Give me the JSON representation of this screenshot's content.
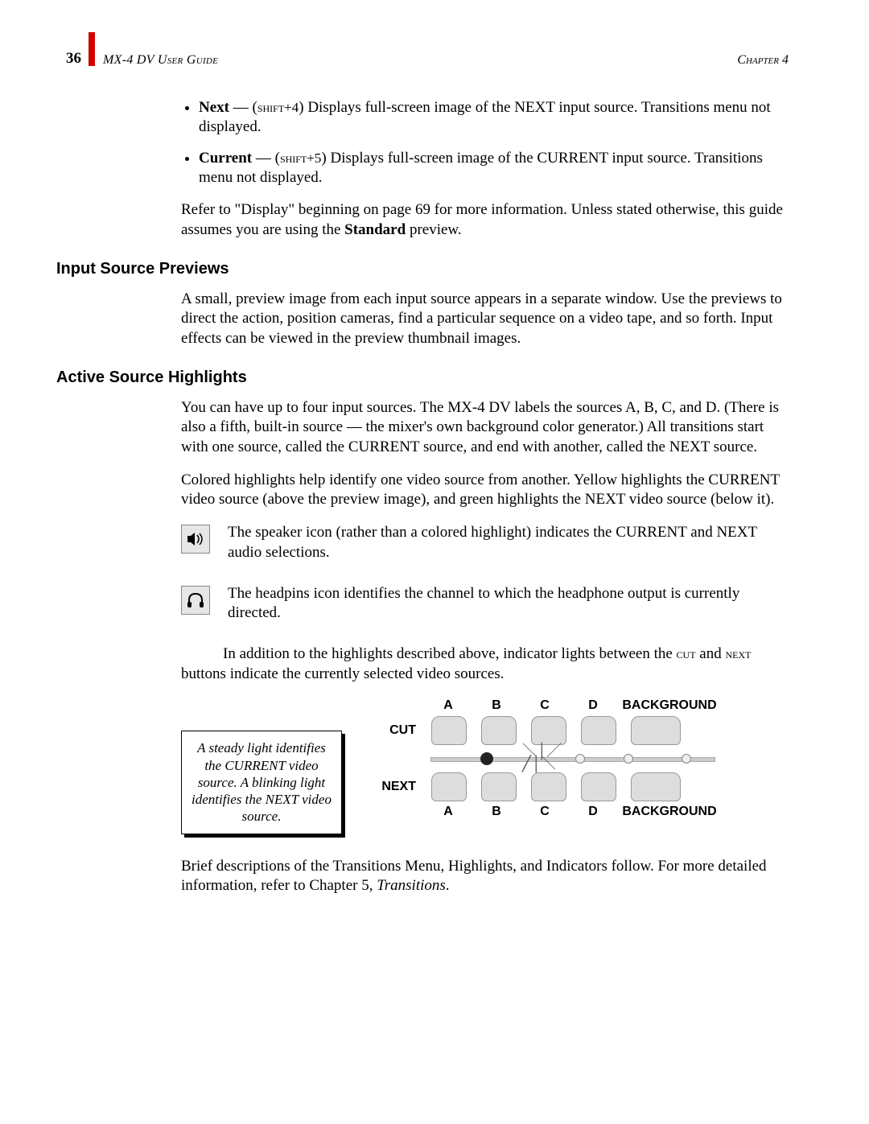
{
  "header": {
    "page_number": "36",
    "guide": "MX-4 DV User Guide",
    "chapter": "Chapter 4"
  },
  "bullets": {
    "next": {
      "label": "Next",
      "shortcut": "shift+4",
      "desc": ") Displays full-screen image of the NEXT input source. Transitions menu not displayed."
    },
    "current": {
      "label": "Current",
      "shortcut": "shift+5",
      "desc": ") Displays full-screen image of the CURRENT input source. Transitions menu not displayed."
    }
  },
  "refer_para_a": "Refer to \"Display\" beginning on page 69 for more information. Unless stated otherwise, this guide assumes you are using the ",
  "refer_bold": "Standard",
  "refer_para_b": " preview.",
  "sections": {
    "input_previews": {
      "heading": "Input Source Previews",
      "para": "A small, preview image from each input source appears in a separate window. Use the previews to direct the action, position cameras, find a particular sequence on a video tape, and so forth. Input effects can be viewed in the preview thumbnail images."
    },
    "active_highlights": {
      "heading": "Active Source Highlights",
      "para1": "You can have up to four input sources. The MX-4 DV labels the sources A, B, C, and D. (There is also a fifth, built-in source — the mixer's own background color generator.) All transitions start with one source, called the CURRENT source, and end with another, called the NEXT source.",
      "para2": "Colored highlights help identify one video source from another. Yellow highlights the CURRENT video source (above the preview image), and green highlights the NEXT video source (below it).",
      "speaker": "The speaker icon (rather than a colored highlight) indicates the CURRENT and NEXT audio selections.",
      "headphones": "The headpins icon identifies the channel to which the headphone output is currently directed.",
      "indicator_a": "In addition to the highlights described above, indicator lights between the ",
      "indicator_cut": "cut",
      "indicator_b": " and ",
      "indicator_next": "next",
      "indicator_c": " buttons indicate the currently selected video sources."
    }
  },
  "callout": "A steady light identifies the CURRENT video source. A blinking light identifies the NEXT video source.",
  "diagram": {
    "labels": {
      "a": "A",
      "b": "B",
      "c": "C",
      "d": "D",
      "bg": "BACKGROUND"
    },
    "rows": {
      "cut": "CUT",
      "next": "NEXT"
    }
  },
  "closing_a": "Brief descriptions of the Transitions Menu, Highlights, and Indicators follow. For more detailed information, refer to Chapter 5, ",
  "closing_em": "Transitions",
  "closing_b": "."
}
